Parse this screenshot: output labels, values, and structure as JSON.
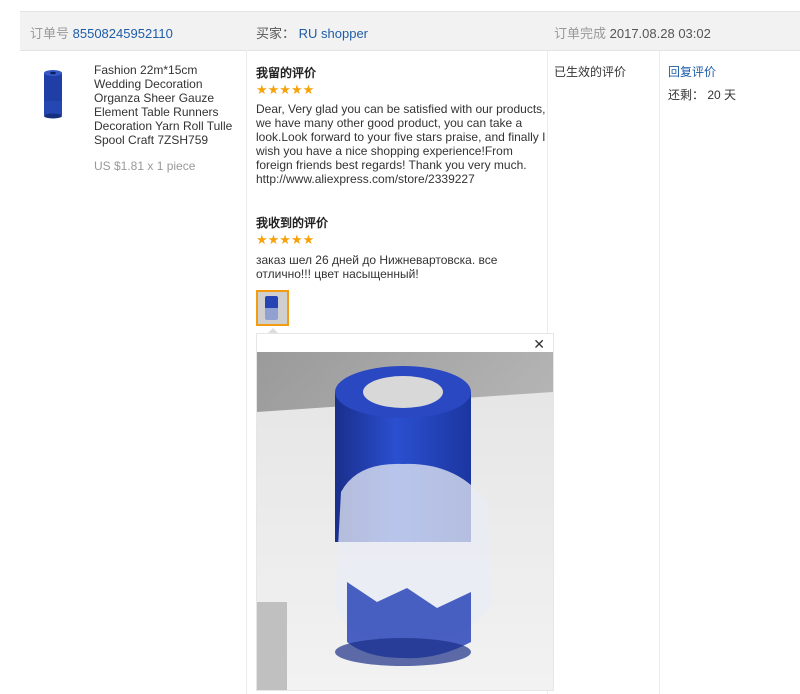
{
  "header": {
    "order_label": "订单号",
    "order_number": "85508245952110",
    "buyer_label": "买家：",
    "buyer_name": "RU shopper",
    "completed_label": "订单完成",
    "completed_time": "2017.08.28 03:02"
  },
  "product": {
    "image_icon": "blue-tulle-roll",
    "title": "Fashion 22m*15cm Wedding Decoration Organza Sheer Gauze Element Table Runners Decoration Yarn Roll Tulle Spool Craft 7ZSH759",
    "price": "US $1.81 x 1 piece"
  },
  "my_review": {
    "heading": "我留的评价",
    "stars": "★★★★★",
    "rating": 5,
    "text": "Dear, Very glad you can be satisfied with our products, we have many other good product, you can take a look.Look forward to your five stars praise, and finally I wish you have a nice shopping experience!From foreign friends best regards! Thank you very much. http://www.aliexpress.com/store/2339227"
  },
  "received_review": {
    "heading": "我收到的评价",
    "stars": "★★★★★",
    "rating": 5,
    "text": "заказ шел 26 дней до Нижневартовска. все отлично!!! цвет насыщенный!",
    "photo_icon": "blue-tulle-roll-photo",
    "close_symbol": "✕"
  },
  "status": {
    "text": "已生效的评价"
  },
  "actions": {
    "reply_label": "回复评价",
    "remaining_text": "还剩： 20 天"
  },
  "colors": {
    "link": "#1e5ca8",
    "star": "#f5a20b",
    "header_bg": "#f2f2f2",
    "thumb_border": "#f39c12",
    "product_blue": "#1f3fa6"
  }
}
